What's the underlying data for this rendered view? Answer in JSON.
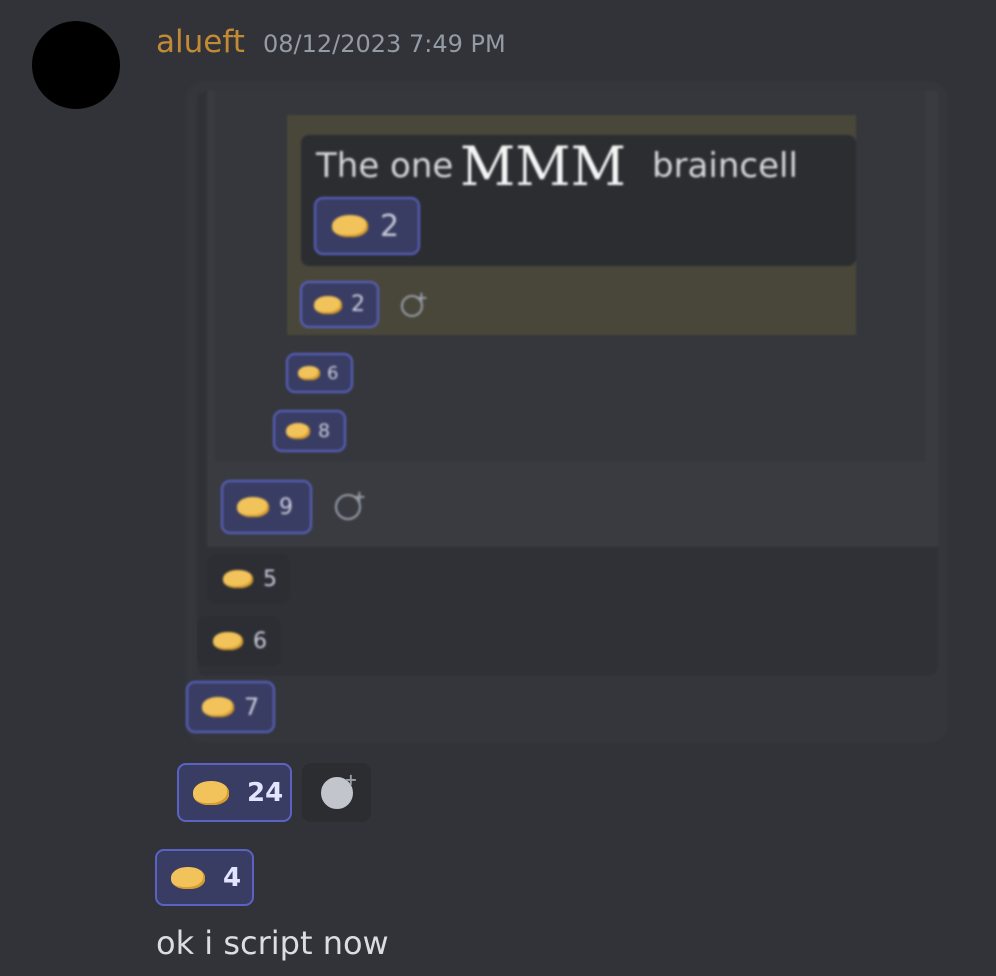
{
  "message": {
    "author": "alueft",
    "timestamp": "08/12/2023 7:49 PM",
    "author_color": "#c38a36",
    "text": "ok i script now"
  },
  "embedded_screenshot": {
    "quote": {
      "left": "The one",
      "big": "MMM",
      "right": "braincell"
    },
    "nested_reactions": [
      {
        "emoji": "handshake",
        "count": "2"
      },
      {
        "emoji": "handshake",
        "count": "2"
      },
      {
        "emoji": "handshake",
        "count": "6"
      },
      {
        "emoji": "handshake",
        "count": "8"
      },
      {
        "emoji": "handshake",
        "count": "9"
      },
      {
        "emoji": "handshake",
        "count": "5"
      },
      {
        "emoji": "handshake",
        "count": "6"
      },
      {
        "emoji": "handshake",
        "count": "7"
      }
    ]
  },
  "reactions": [
    {
      "emoji": "handshake",
      "count": "24",
      "selected": true
    },
    {
      "emoji": "handshake",
      "count": "4",
      "selected": true
    }
  ],
  "colors": {
    "background": "#313338",
    "reaction_selected_bg": "#393d63",
    "reaction_selected_border": "#5a62c4",
    "emoji": "#f2c35a"
  }
}
